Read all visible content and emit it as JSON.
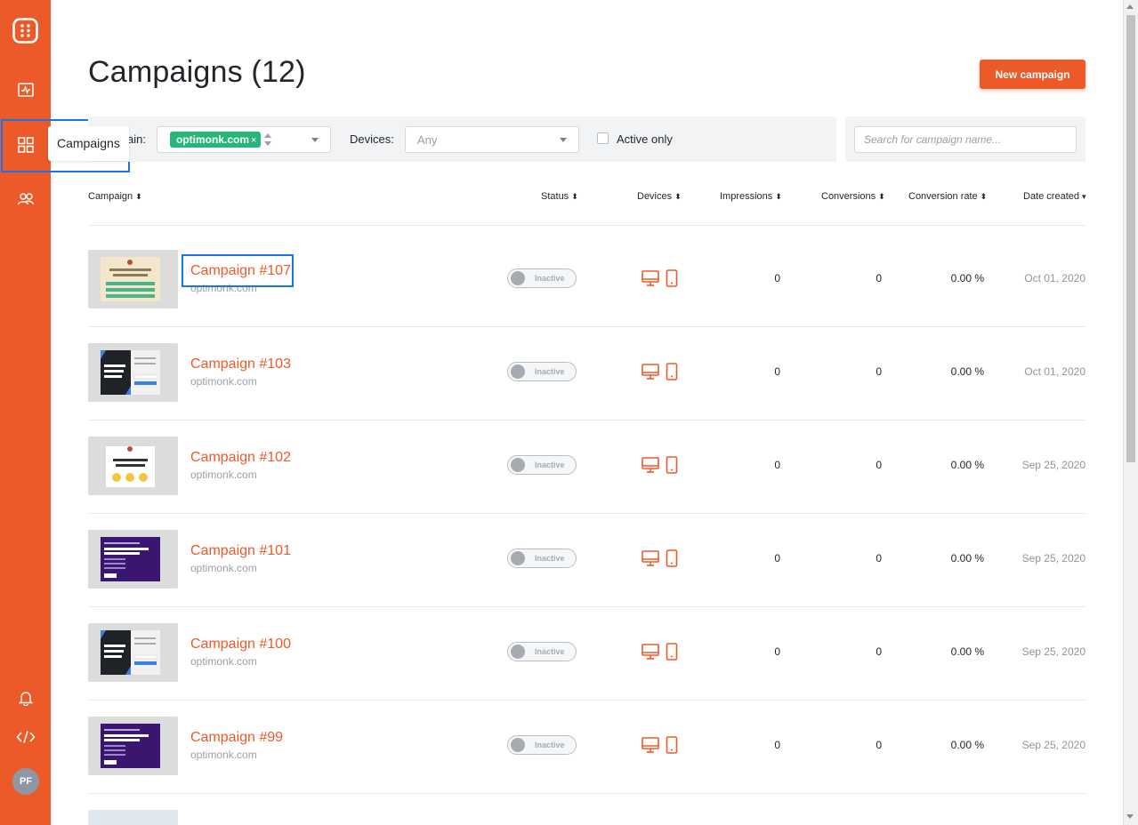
{
  "sidebar": {
    "logo_icon": "optimonk-logo-icon",
    "items": [
      {
        "name": "analytics",
        "icon": "activity-icon"
      },
      {
        "name": "campaigns",
        "icon": "grid-icon",
        "active": true
      },
      {
        "name": "subscribers",
        "icon": "users-icon"
      }
    ],
    "tooltip": "Campaigns",
    "bottom": [
      {
        "name": "notifications",
        "icon": "bell-icon"
      },
      {
        "name": "code",
        "icon": "code-icon"
      }
    ],
    "avatar_initials": "PF"
  },
  "header": {
    "title": "Campaigns (12)",
    "new_campaign_label": "New campaign"
  },
  "filters": {
    "domain_label": "ain:",
    "domain_tag": "optimonk.com",
    "domain_tag_remove": "×",
    "devices_label": "Devices:",
    "devices_value": "Any",
    "active_only_label": "Active only",
    "search_placeholder": "Search for campaign name..."
  },
  "table": {
    "columns": {
      "campaign": "Campaign",
      "status": "Status",
      "devices": "Devices",
      "impressions": "Impressions",
      "conversions": "Conversions",
      "conversion_rate": "Conversion rate",
      "date_created": "Date created"
    },
    "sort_icon": "sort-icon",
    "rows": [
      {
        "name": "Campaign #107",
        "domain": "optimonk.com",
        "status": "Inactive",
        "impressions": "0",
        "conversions": "0",
        "conversion_rate": "0.00 %",
        "date": "Oct 01, 2020",
        "thumb": "survey-beige"
      },
      {
        "name": "Campaign #103",
        "domain": "optimonk.com",
        "status": "Inactive",
        "impressions": "0",
        "conversions": "0",
        "conversion_rate": "0.00 %",
        "date": "Oct 01, 2020",
        "thumb": "dark-signup"
      },
      {
        "name": "Campaign #102",
        "domain": "optimonk.com",
        "status": "Inactive",
        "impressions": "0",
        "conversions": "0",
        "conversion_rate": "0.00 %",
        "date": "Sep 25, 2020",
        "thumb": "feedback-emoji"
      },
      {
        "name": "Campaign #101",
        "domain": "optimonk.com",
        "status": "Inactive",
        "impressions": "0",
        "conversions": "0",
        "conversion_rate": "0.00 %",
        "date": "Sep 25, 2020",
        "thumb": "purple-quiz"
      },
      {
        "name": "Campaign #100",
        "domain": "optimonk.com",
        "status": "Inactive",
        "impressions": "0",
        "conversions": "0",
        "conversion_rate": "0.00 %",
        "date": "Sep 25, 2020",
        "thumb": "dark-signup"
      },
      {
        "name": "Campaign #99",
        "domain": "optimonk.com",
        "status": "Inactive",
        "impressions": "0",
        "conversions": "0",
        "conversion_rate": "0.00 %",
        "date": "Sep 25, 2020",
        "thumb": "purple-quiz"
      }
    ]
  },
  "colors": {
    "brand": "#ed5a29",
    "tag_green": "#27b57a",
    "highlight": "#1a73e8"
  }
}
